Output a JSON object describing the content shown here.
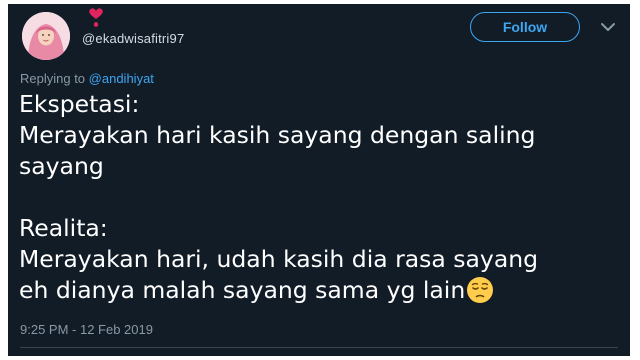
{
  "user": {
    "handle": "@ekadwisafitri97",
    "avatar_icon": "profile-photo-hijab",
    "badge_icon": "red-heart-icon"
  },
  "follow_button": {
    "label": "Follow"
  },
  "menu": {
    "icon": "chevron-down-icon"
  },
  "reply": {
    "prefix": "Replying to",
    "mention": "@andihiyat"
  },
  "tweet": {
    "lines": [
      "Ekspetasi:",
      "Merayakan hari kasih sayang dengan saling",
      "sayang",
      "Realita:",
      "Merayakan hari, udah kasih dia rasa sayang",
      "eh dianya malah sayang sama yg lain"
    ],
    "emoji": "pensive-face-emoji"
  },
  "timestamp": "9:25 PM - 12 Feb 2019",
  "colors": {
    "background": "#121c27",
    "accent": "#3ea5f0",
    "muted": "#8899a6",
    "text": "#ffffff"
  }
}
